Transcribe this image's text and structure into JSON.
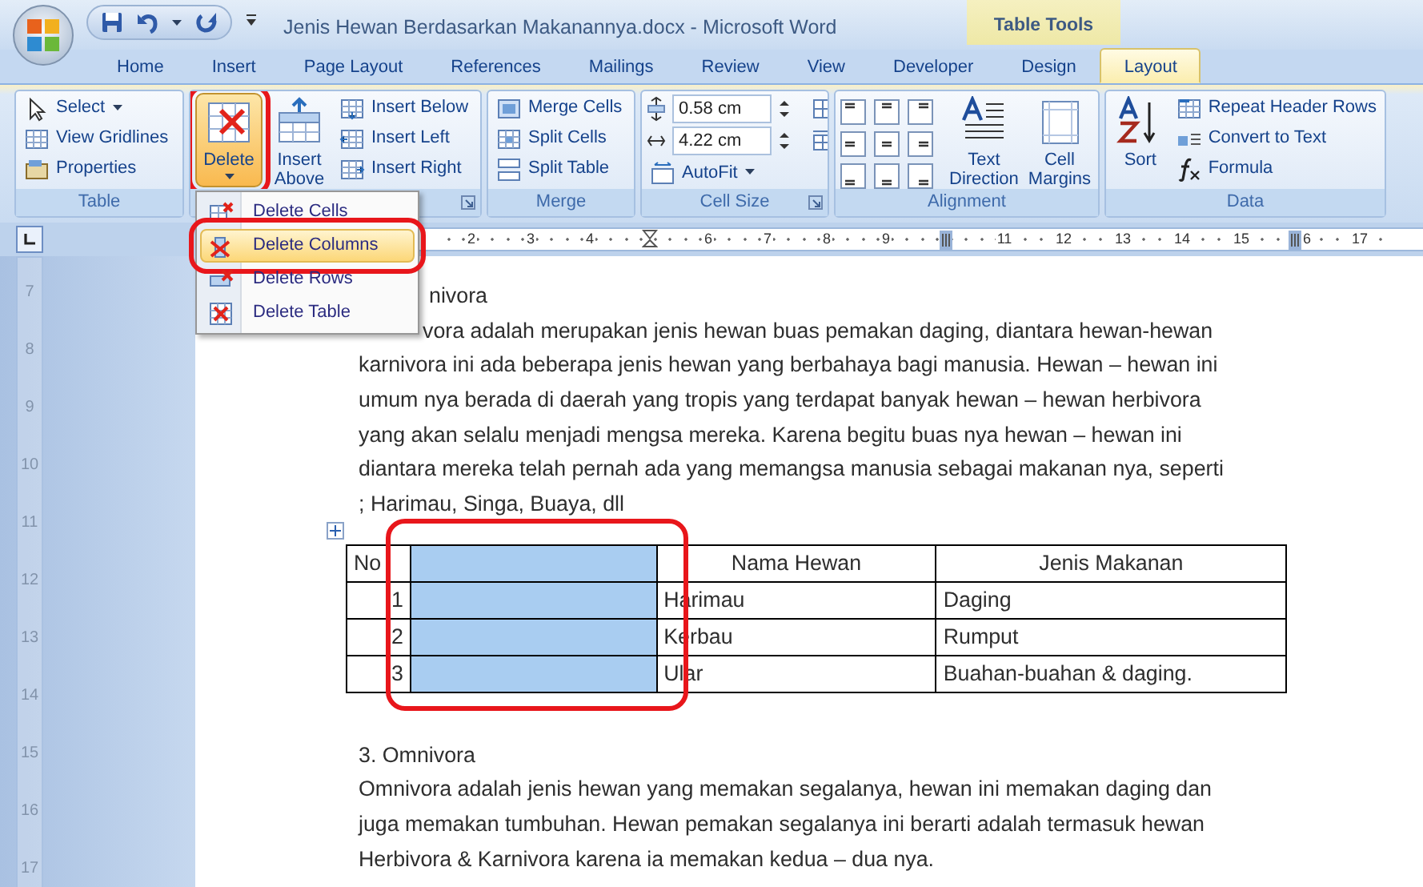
{
  "window": {
    "title": "Jenis Hewan Berdasarkan Makanannya.docx - Microsoft Word",
    "context_group": "Table Tools"
  },
  "tabs": [
    {
      "label": "Home",
      "selected": false
    },
    {
      "label": "Insert",
      "selected": false
    },
    {
      "label": "Page Layout",
      "selected": false
    },
    {
      "label": "References",
      "selected": false
    },
    {
      "label": "Mailings",
      "selected": false
    },
    {
      "label": "Review",
      "selected": false
    },
    {
      "label": "View",
      "selected": false
    },
    {
      "label": "Developer",
      "selected": false
    },
    {
      "label": "Design",
      "selected": false
    },
    {
      "label": "Layout",
      "selected": true
    }
  ],
  "ribbon": {
    "groups": [
      {
        "label": "Table",
        "items": [
          {
            "kind": "small",
            "label": "Select",
            "menu": true
          },
          {
            "kind": "small",
            "label": "View Gridlines"
          },
          {
            "kind": "small",
            "label": "Properties"
          }
        ]
      },
      {
        "launcher": true,
        "items": [
          {
            "kind": "large",
            "label": "Delete",
            "menu": true,
            "open": true,
            "highlighted": true
          },
          {
            "kind": "large",
            "label": "Insert Above"
          },
          {
            "kind": "small",
            "label": "Insert Below"
          },
          {
            "kind": "small",
            "label": "Insert Left"
          },
          {
            "kind": "small",
            "label": "Insert Right"
          }
        ]
      },
      {
        "label": "Merge",
        "items": [
          {
            "kind": "small",
            "label": "Merge Cells"
          },
          {
            "kind": "small",
            "label": "Split Cells"
          },
          {
            "kind": "small",
            "label": "Split Table"
          }
        ]
      },
      {
        "label": "Cell Size",
        "launcher": true,
        "items": [
          {
            "kind": "spin",
            "value": "0.58 cm"
          },
          {
            "kind": "spin",
            "value": "4.22 cm"
          },
          {
            "kind": "small",
            "label": "AutoFit",
            "menu": true
          }
        ]
      },
      {
        "label": "Alignment",
        "items": [
          {
            "kind": "align-grid"
          },
          {
            "kind": "large",
            "label": "Text Direction"
          },
          {
            "kind": "large",
            "label": "Cell Margins"
          }
        ]
      },
      {
        "label": "Data",
        "items": [
          {
            "kind": "large",
            "label": "Sort"
          },
          {
            "kind": "small",
            "label": "Repeat Header Rows"
          },
          {
            "kind": "small",
            "label": "Convert to Text"
          },
          {
            "kind": "small",
            "label": "Formula"
          }
        ]
      }
    ]
  },
  "delete_menu": {
    "items": [
      {
        "label": "Delete Cells",
        "selected": false
      },
      {
        "label": "Delete Columns",
        "selected": true,
        "highlighted": true
      },
      {
        "label": "Delete Rows",
        "selected": false
      },
      {
        "label": "Delete Table",
        "selected": false
      }
    ]
  },
  "horizontal_ruler": [
    {
      "kind": "number",
      "label": "2"
    },
    {
      "kind": "number",
      "label": "3"
    },
    {
      "kind": "number",
      "label": "4"
    },
    {
      "kind": "indent"
    },
    {
      "kind": "number",
      "label": "6"
    },
    {
      "kind": "number",
      "label": "7"
    },
    {
      "kind": "number",
      "label": "8"
    },
    {
      "kind": "number",
      "label": "9"
    },
    {
      "kind": "marker"
    },
    {
      "kind": "number",
      "label": "11"
    },
    {
      "kind": "number",
      "label": "12"
    },
    {
      "kind": "number",
      "label": "13"
    },
    {
      "kind": "number",
      "label": "14"
    },
    {
      "kind": "number",
      "label": "15"
    },
    {
      "kind": "marker-number",
      "label": "6"
    },
    {
      "kind": "number",
      "label": "17"
    }
  ],
  "vertical_ruler": [
    "7",
    "8",
    "9",
    "10",
    "11",
    "12",
    "13",
    "14",
    "15",
    "16",
    "17"
  ],
  "document": {
    "blocks": [
      {
        "kind": "heading",
        "text": "nivora",
        "covered_by_menu": true
      },
      {
        "kind": "paragraph",
        "covered_by_menu": true,
        "lines": [
          "vora adalah merupakan jenis hewan buas pemakan daging, diantara hewan-hewan",
          "karnivora ini ada beberapa jenis hewan yang berbahaya bagi manusia. Hewan – hewan ini",
          "umum nya berada di daerah yang tropis yang terdapat banyak hewan – hewan herbivora",
          "yang akan selalu menjadi mengsa mereka. Karena begitu buas nya hewan – hewan ini",
          "diantara mereka telah pernah ada yang memangsa manusia sebagai makanan nya, seperti",
          "; Harimau, Singa, Buaya, dll"
        ]
      },
      {
        "kind": "table",
        "columns": [
          {
            "label": "No",
            "selected": false
          },
          {
            "selected": true,
            "highlighted": true
          },
          {
            "label": "Nama Hewan",
            "selected": false
          },
          {
            "label": "Jenis Makanan",
            "selected": false
          }
        ],
        "rows": [
          {
            "no": "1",
            "nama": "Harimau",
            "jenis": "Daging"
          },
          {
            "no": "2",
            "nama": "Kerbau",
            "jenis": "Rumput"
          },
          {
            "no": "3",
            "nama": "Ular",
            "jenis": "Buahan-buahan & daging."
          }
        ]
      },
      {
        "kind": "heading",
        "text": "3. Omnivora",
        "covered_by_menu": false
      },
      {
        "kind": "paragraph",
        "covered_by_menu": false,
        "lines": [
          "Omnivora adalah jenis hewan yang memakan segalanya, hewan ini memakan daging dan",
          "juga memakan tumbuhan.  Hewan pemakan segalanya ini berarti adalah termasuk hewan",
          "Herbivora & Karnivora karena ia memakan kedua  – dua nya."
        ]
      }
    ]
  }
}
